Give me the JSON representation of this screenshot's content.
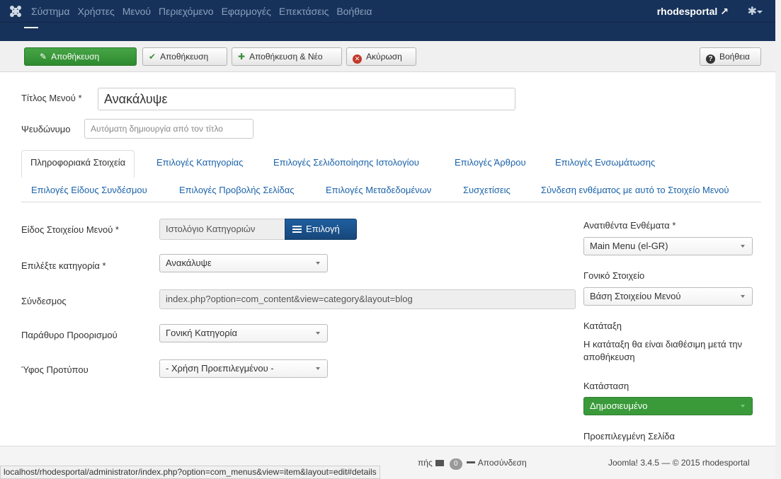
{
  "nav": {
    "menu": [
      "Σύστημα",
      "Χρήστες",
      "Μενού",
      "Περιεχόμενο",
      "Εφαρμογές",
      "Επεκτάσεις",
      "Βοήθεια"
    ],
    "user": "rhodesportal",
    "logo_icon": "joomla-logo-icon",
    "gear_icon": "gear-icon"
  },
  "toolbar": {
    "save_label": "Αποθήκευση",
    "save_close_label": "Αποθήκευση",
    "save_new_label": "Αποθήκευση & Νέο",
    "cancel_label": "Ακύρωση",
    "help_label": "Βοήθεια"
  },
  "form": {
    "title_label": "Τίτλος Μενού *",
    "title_value": "Ανακάλυψε",
    "alias_label": "Ψευδώνυμο",
    "alias_placeholder": "Αυτόματη δημιουργία από τον τίτλο"
  },
  "tabs": {
    "row1": [
      "Πληροφοριακά Στοιχεία",
      "Επιλογές Κατηγορίας",
      "Επιλογές Σελιδοποίησης Ιστολογίου",
      "Επιλογές Άρθρου",
      "Επιλογές Ενσωμάτωσης"
    ],
    "row2": [
      "Επιλογές Είδους Συνδέσμου",
      "Επιλογές Προβολής Σελίδας",
      "Επιλογές Μεταδεδομένων",
      "Συσχετίσεις",
      "Σύνδεση ενθέματος με αυτό το Στοιχείο Μενού"
    ],
    "active": "Πληροφοριακά Στοιχεία"
  },
  "details": {
    "type_label": "Είδος Στοιχείου Μενού *",
    "type_value": "Ιστολόγιο Κατηγοριών",
    "select_button": "Επιλογή",
    "category_label": "Επιλέξτε κατηγορία *",
    "category_value": "Ανακάλυψε",
    "link_label": "Σύνδεσμος",
    "link_value": "index.php?option=com_content&view=category&layout=blog",
    "target_label": "Παράθυρο Προορισμού",
    "target_value": "Γονική Κατηγορία",
    "style_label": "Ύφος Προτύπου",
    "style_value": "- Χρήση Προεπιλεγμένου -"
  },
  "sidebar": {
    "menu_label": "Ανατιθέντα Ενθέματα *",
    "menu_value": "Main Menu (el-GR)",
    "parent_label": "Γονικό Στοιχείο",
    "parent_value": "Βάση Στοιχείου Μενού",
    "ordering_label": "Κατάταξη",
    "ordering_note": "Η κατάταξη θα είναι διαθέσιμη μετά την αποθήκευση",
    "status_label": "Κατάσταση",
    "status_value": "Δημοσιευμένο",
    "status_color": "#3a9a3a",
    "default_label": "Προεπιλεγμένη Σελίδα"
  },
  "statusbar": {
    "url": "localhost/rhodesportal/administrator/index.php?option=com_menus&view=item&layout=edit#details",
    "partial_text": "πής",
    "messages_count": "0",
    "logout_label": "Αποσύνδεση",
    "footer": "Joomla! 3.4.5 — © 2015 rhodesportal"
  }
}
